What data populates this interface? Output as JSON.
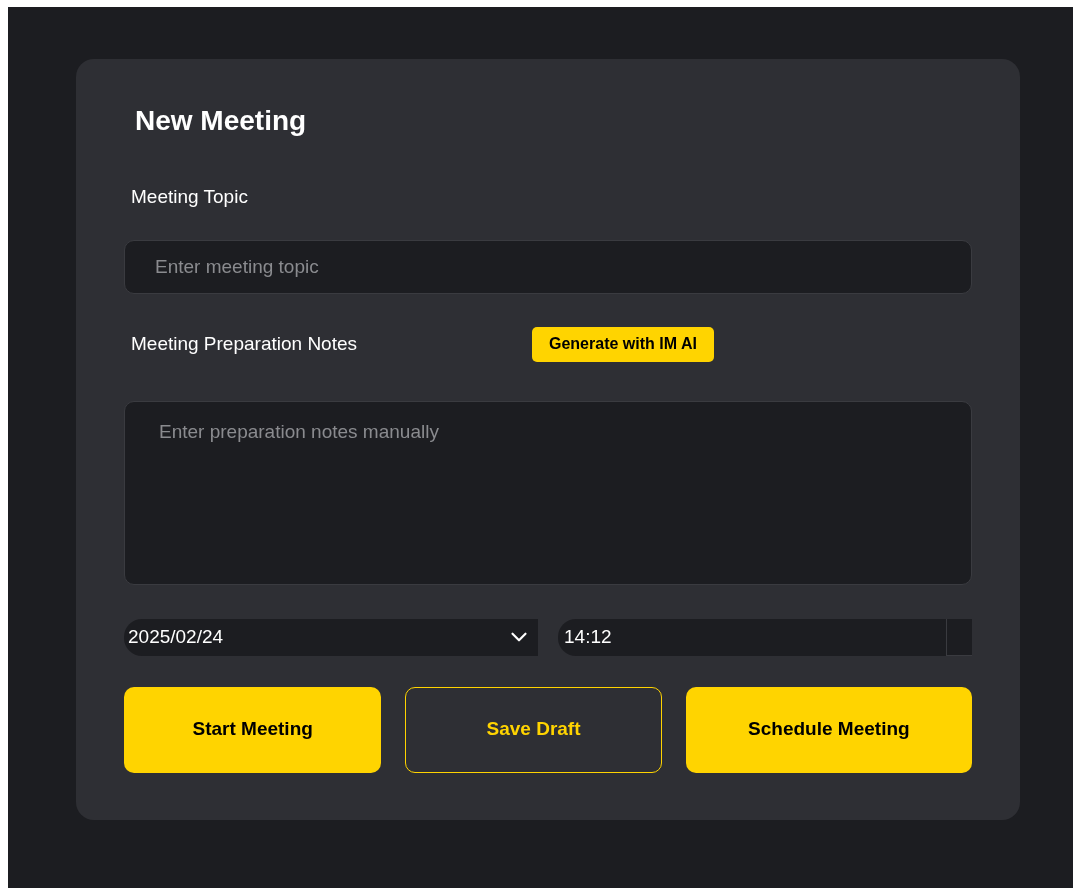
{
  "title": "New Meeting",
  "topic": {
    "label": "Meeting Topic",
    "placeholder": "Enter meeting topic"
  },
  "notes": {
    "label": "Meeting Preparation Notes",
    "ai_button": "Generate with IM AI",
    "placeholder": "Enter preparation notes manually"
  },
  "date": {
    "value": "2025/02/24"
  },
  "time": {
    "value": "14:12"
  },
  "buttons": [
    {
      "label": "Start Meeting",
      "kind": "primary"
    },
    {
      "label": "Save Draft",
      "kind": "outline"
    },
    {
      "label": "Schedule Meeting",
      "kind": "primary"
    }
  ]
}
